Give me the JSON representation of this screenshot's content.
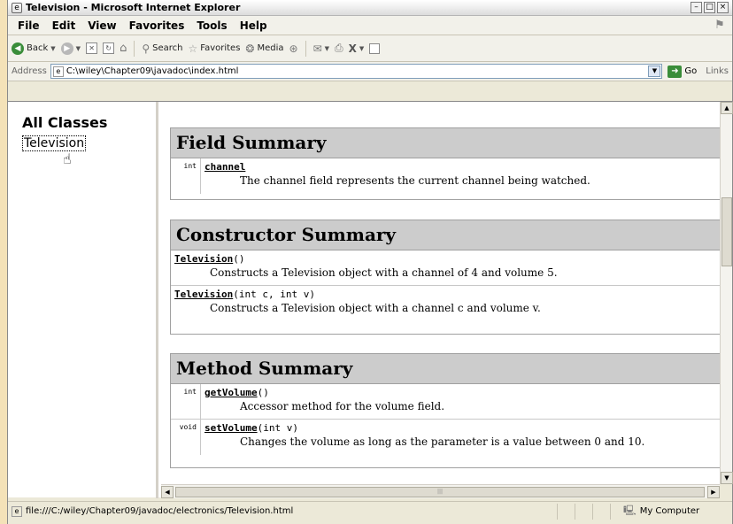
{
  "window": {
    "title": "Television - Microsoft Internet Explorer",
    "controls": [
      "–",
      "□",
      "×"
    ]
  },
  "menu": [
    "File",
    "Edit",
    "View",
    "Favorites",
    "Tools",
    "Help"
  ],
  "toolbar": {
    "back_label": "Back",
    "search_label": "Search",
    "favorites_label": "Favorites",
    "media_label": "Media"
  },
  "address": {
    "label": "Address",
    "url": "C:\\wiley\\Chapter09\\javadoc\\index.html",
    "go_label": "Go",
    "links_label": "Links"
  },
  "left_frame": {
    "heading": "All Classes",
    "class_link": "Television"
  },
  "field_summary": {
    "heading": "Field Summary",
    "rows": [
      {
        "type": "int",
        "name": "channel",
        "params": "",
        "description": "The channel field represents the current channel being watched."
      }
    ]
  },
  "constructor_summary": {
    "heading": "Constructor Summary",
    "rows": [
      {
        "name": "Television",
        "params": "()",
        "description": "Constructs a Television object with a channel of 4 and volume 5."
      },
      {
        "name": "Television",
        "params": "(int c, int v)",
        "description": "Constructs a Television object with a channel c and volume v."
      }
    ]
  },
  "method_summary": {
    "heading": "Method Summary",
    "rows": [
      {
        "type": "int",
        "name": "getVolume",
        "params": "()",
        "description": "Accessor method for the volume field."
      },
      {
        "type": "void",
        "name": "setVolume",
        "params": "(int v)",
        "description": "Changes the volume as long as the parameter is a value between 0 and 10."
      }
    ]
  },
  "status": {
    "text": "file:///C:/wiley/Chapter09/javadoc/electronics/Television.html",
    "zone": "My Computer"
  },
  "colors": {
    "header_bg": "#cccccc",
    "chrome_bg": "#ece9d8",
    "desktop_bg": "#f4e2b8"
  }
}
